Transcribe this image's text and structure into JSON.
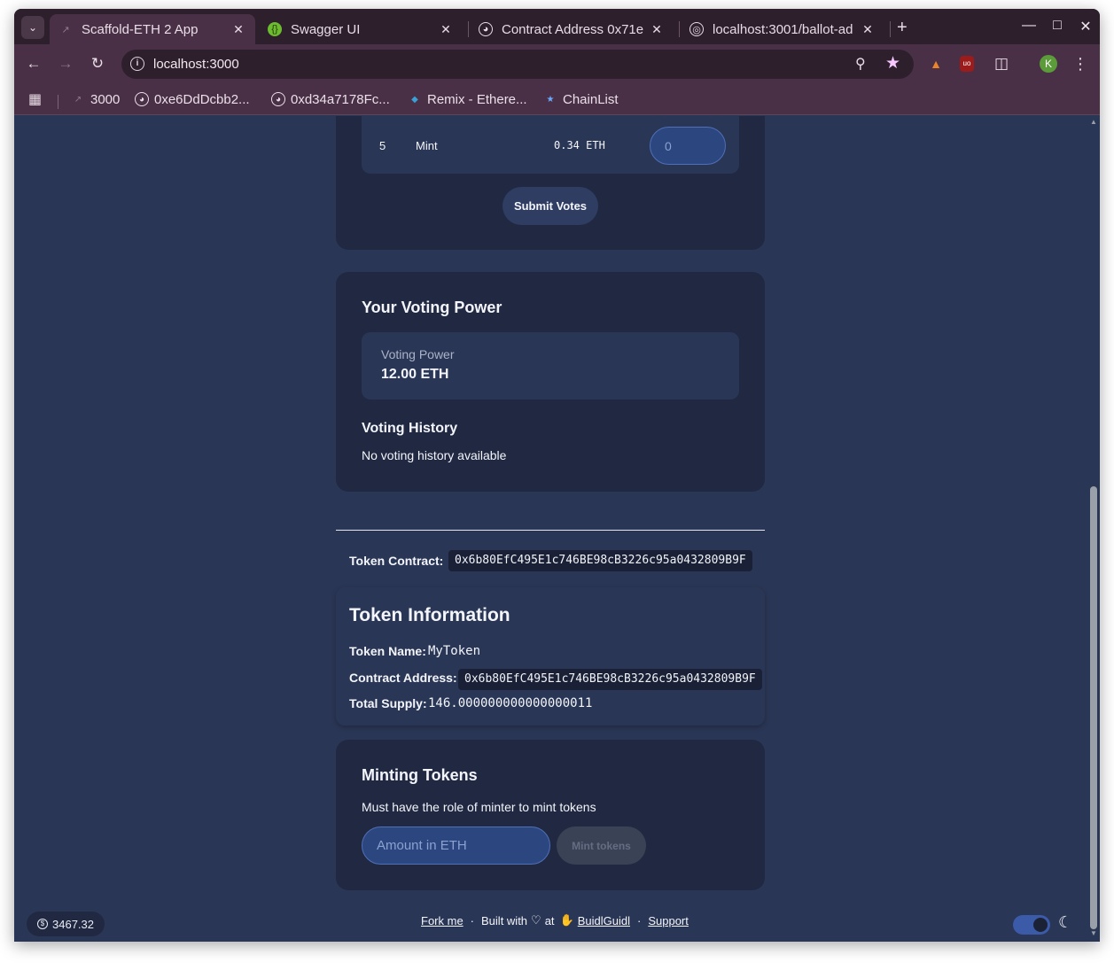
{
  "browser": {
    "tabs": [
      {
        "title": "Scaffold-ETH 2 App",
        "active": true,
        "icon": "scaffold-eth-icon"
      },
      {
        "title": "Swagger UI",
        "active": false,
        "icon": "swagger-icon"
      },
      {
        "title": "Contract Address 0x71e",
        "active": false,
        "icon": "etherscan-icon"
      },
      {
        "title": "localhost:3001/ballot-ad",
        "active": false,
        "icon": "globe-icon"
      }
    ],
    "url": "localhost:3000",
    "profile_initial": "K",
    "bookmarks": [
      {
        "label": "3000",
        "icon": "scaffold-eth-icon"
      },
      {
        "label": "0xe6DdDcbb2...",
        "icon": "etherscan-icon"
      },
      {
        "label": "0xd34a7178Fc...",
        "icon": "etherscan-icon"
      },
      {
        "label": "Remix - Ethere...",
        "icon": "remix-icon"
      },
      {
        "label": "ChainList",
        "icon": "chainlist-icon"
      }
    ]
  },
  "vote_table": {
    "row": {
      "index": "5",
      "name": "Mint",
      "price": "0.34 ETH",
      "input_value": "0"
    },
    "submit_label": "Submit Votes"
  },
  "voting_power": {
    "title": "Your Voting Power",
    "label": "Voting Power",
    "value": "12.00 ETH",
    "history_title": "Voting History",
    "history_empty": "No voting history available"
  },
  "token_contract": {
    "label": "Token Contract:",
    "address": "0x6b80EfC495E1c746BE98cB3226c95a0432809B9F"
  },
  "token_info": {
    "title": "Token Information",
    "name_label": "Token Name:",
    "name_value": "MyToken",
    "address_label": "Contract Address:",
    "address_value": "0x6b80EfC495E1c746BE98cB3226c95a0432809B9F",
    "supply_label": "Total Supply:",
    "supply_value": "146.000000000000000011"
  },
  "minting": {
    "title": "Minting Tokens",
    "note": "Must have the role of minter to mint tokens",
    "amount_placeholder": "Amount in ETH",
    "mint_label": "Mint tokens"
  },
  "footer": {
    "fork": "Fork me",
    "dot": "·",
    "built_with": "Built with",
    "at": "at",
    "buidlguidl": "BuidlGuidl",
    "support": "Support",
    "eth_price": "3467.32"
  }
}
